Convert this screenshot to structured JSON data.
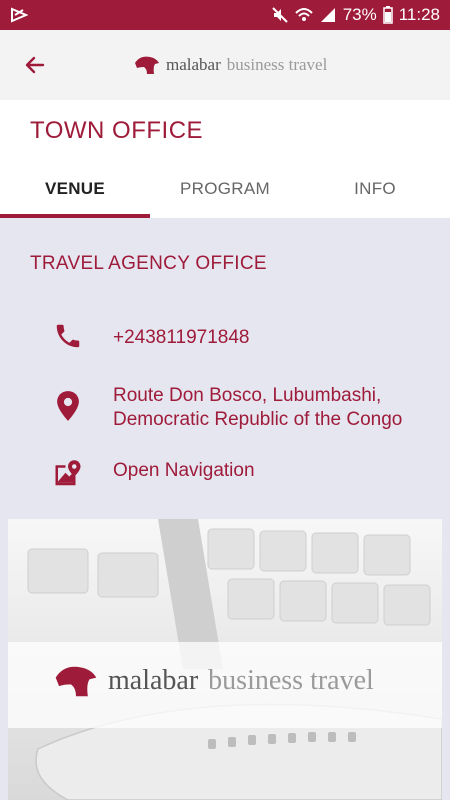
{
  "status_bar": {
    "battery_percent": "73%",
    "time": "11:28"
  },
  "app_bar": {
    "brand_name": "malabar",
    "brand_suffix": "business travel"
  },
  "page": {
    "title": "TOWN OFFICE"
  },
  "tabs": [
    {
      "label": "VENUE",
      "active": true
    },
    {
      "label": "PROGRAM",
      "active": false
    },
    {
      "label": "INFO",
      "active": false
    }
  ],
  "venue": {
    "section_title": "TRAVEL AGENCY OFFICE",
    "phone": "+243811971848",
    "address_line1": "Route Don Bosco, Lubumbashi,",
    "address_line2": "Democratic Republic of the Congo",
    "navigation_label": "Open Navigation"
  },
  "banner": {
    "brand_name": "malabar",
    "brand_suffix": "business travel"
  },
  "colors": {
    "brand": "#9e1b3a",
    "content_bg": "#e6e6f0"
  }
}
